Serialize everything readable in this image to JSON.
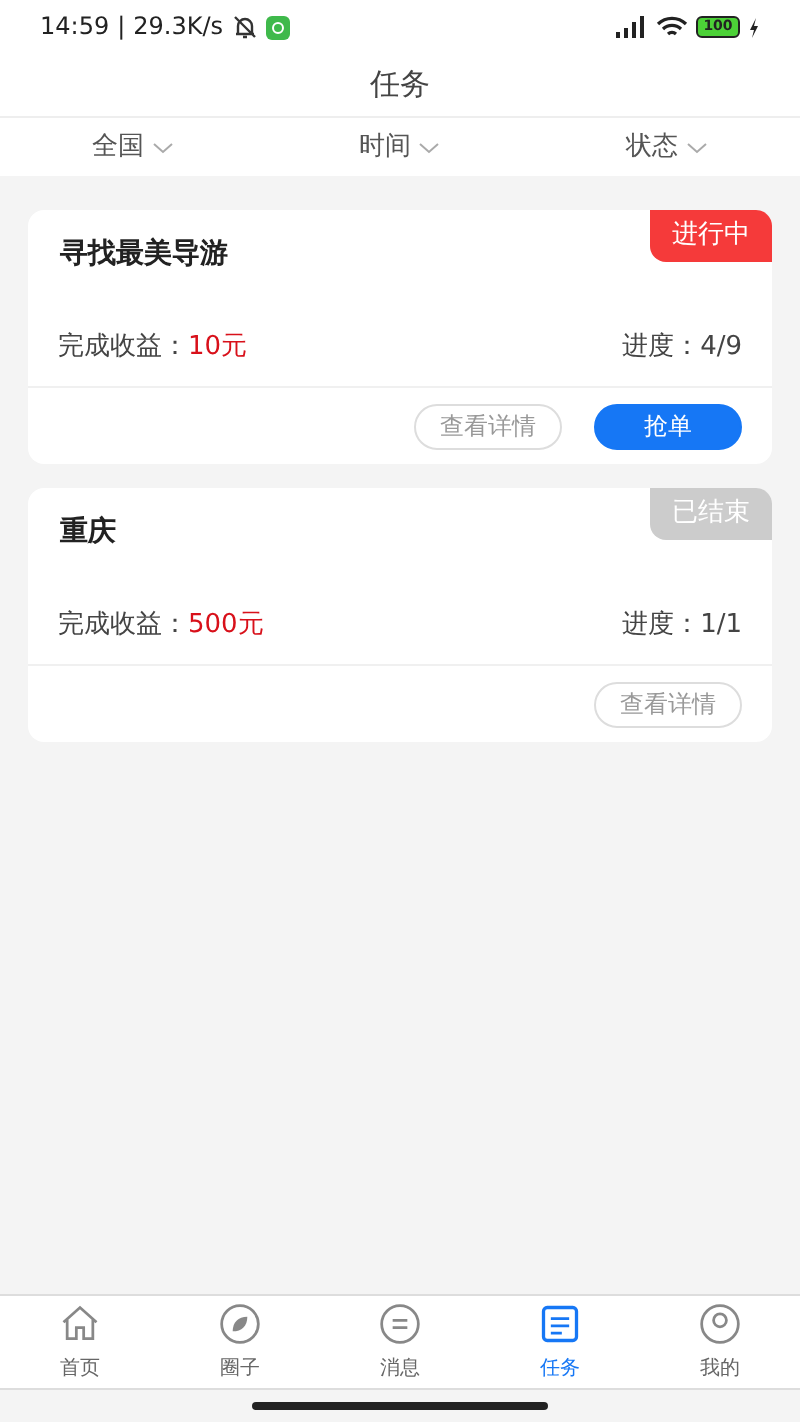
{
  "status_bar": {
    "time": "14:59",
    "divider": "|",
    "speed": "29.3K/s",
    "battery": "100"
  },
  "header": {
    "title": "任务"
  },
  "filters": [
    {
      "label": "全国"
    },
    {
      "label": "时间"
    },
    {
      "label": "状态"
    }
  ],
  "tasks": [
    {
      "title": "寻找最美导游",
      "status": {
        "label": "进行中",
        "color": "#f53a3a"
      },
      "reward_label": "完成收益：",
      "reward": "10元",
      "progress_label": "进度：",
      "progress": "4/9",
      "buttons": [
        {
          "label": "查看详情",
          "kind": "outline"
        },
        {
          "label": "抢单",
          "kind": "primary"
        }
      ]
    },
    {
      "title": "重庆",
      "status": {
        "label": "已结束",
        "color": "#cccccc"
      },
      "reward_label": "完成收益：",
      "reward": "500元",
      "progress_label": "进度：",
      "progress": "1/1",
      "buttons": [
        {
          "label": "查看详情",
          "kind": "outline"
        }
      ]
    }
  ],
  "tab_bar": [
    {
      "label": "首页",
      "kind": "home",
      "selected": false
    },
    {
      "label": "圈子",
      "kind": "compass",
      "selected": false
    },
    {
      "label": "消息",
      "kind": "message",
      "selected": false
    },
    {
      "label": "任务",
      "kind": "task",
      "selected": true
    },
    {
      "label": "我的",
      "kind": "user",
      "selected": false
    }
  ]
}
